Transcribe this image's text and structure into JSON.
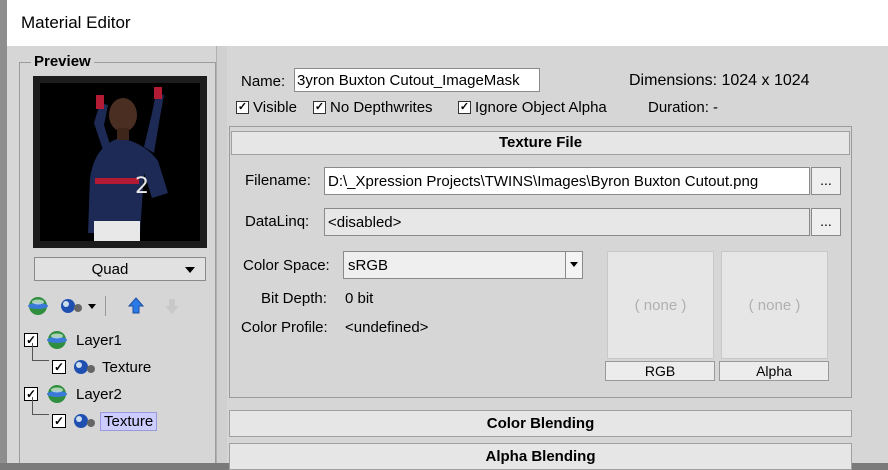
{
  "window": {
    "title": "Material Editor"
  },
  "preview": {
    "label": "Preview",
    "shape_dropdown": "Quad",
    "tree": [
      {
        "label": "Layer1",
        "checked": true
      },
      {
        "label": "Texture",
        "checked": true
      },
      {
        "label": "Layer2",
        "checked": true
      },
      {
        "label": "Texture",
        "checked": true,
        "selected": true
      }
    ]
  },
  "props": {
    "name_label": "Name:",
    "name_value": "3yron Buxton Cutout_ImageMask",
    "dimensions": "Dimensions: 1024 x 1024",
    "visible": "Visible",
    "no_depthwrites": "No Depthwrites",
    "ignore_alpha": "Ignore Object Alpha",
    "duration": "Duration: -"
  },
  "texture_file": {
    "header": "Texture File",
    "filename_label": "Filename:",
    "filename_value": "D:\\_Xpression Projects\\TWINS\\Images\\Byron Buxton Cutout.png",
    "browse_label": "...",
    "dataling_label": "DataLinq:",
    "dataling_value": "<disabled>",
    "color_space_label": "Color Space:",
    "color_space_value": "sRGB",
    "bit_depth_label": "Bit Depth:",
    "bit_depth_value": "0 bit",
    "color_profile_label": "Color Profile:",
    "color_profile_value": "<undefined>",
    "rgb_none": "( none )",
    "alpha_none": "( none )",
    "rgb_caption": "RGB",
    "alpha_caption": "Alpha"
  },
  "sections": {
    "color_blending": "Color Blending",
    "alpha_blending": "Alpha Blending"
  },
  "colors": {
    "panel": "#d6d6d6",
    "selected": "#ccccff"
  }
}
